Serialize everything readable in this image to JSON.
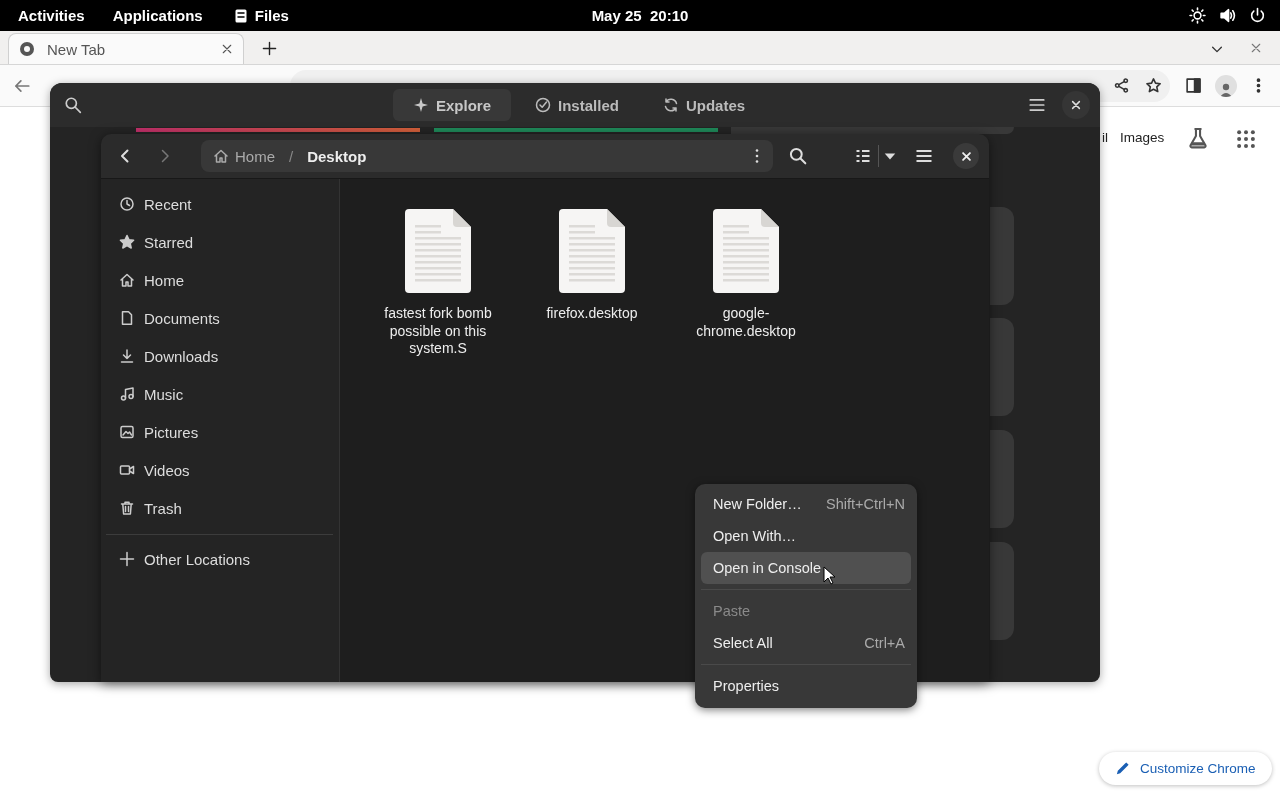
{
  "top_bar": {
    "activities": "Activities",
    "applications": "Applications",
    "app_name": "Files",
    "clock": "May 25  20:10"
  },
  "browser": {
    "tabs": [
      {
        "label": "New Tab",
        "selected": true
      }
    ],
    "page_links": [
      "il",
      "Images"
    ],
    "customize_button": "Customize Chrome"
  },
  "software_window": {
    "tabs": [
      {
        "label": "Explore",
        "selected": true
      },
      {
        "label": "Installed",
        "selected": false
      },
      {
        "label": "Updates",
        "selected": false
      }
    ]
  },
  "files_window": {
    "path": [
      {
        "label": "Home",
        "selected": false
      },
      {
        "label": "Desktop",
        "selected": true
      }
    ],
    "separator": "/",
    "sidebar": [
      {
        "label": "Recent"
      },
      {
        "label": "Starred"
      },
      {
        "label": "Home"
      },
      {
        "label": "Documents"
      },
      {
        "label": "Downloads"
      },
      {
        "label": "Music"
      },
      {
        "label": "Pictures"
      },
      {
        "label": "Videos"
      },
      {
        "label": "Trash"
      }
    ],
    "other_locations": "Other Locations",
    "files": [
      {
        "name": "fastest fork bomb possible on this system.S"
      },
      {
        "name": "firefox.desktop"
      },
      {
        "name": "google-chrome.desktop"
      }
    ]
  },
  "context_menu": {
    "groups": [
      [
        {
          "label": "New Folder…",
          "shortcut": "Shift+Ctrl+N",
          "disabled": false,
          "selected": false
        },
        {
          "label": "Open With…",
          "disabled": false,
          "selected": false
        },
        {
          "label": "Open in Console",
          "disabled": false,
          "selected": true
        }
      ],
      [
        {
          "label": "Paste",
          "disabled": true,
          "selected": false
        },
        {
          "label": "Select All",
          "shortcut": "Ctrl+A",
          "disabled": false,
          "selected": false
        }
      ],
      [
        {
          "label": "Properties",
          "disabled": false,
          "selected": false
        }
      ]
    ]
  }
}
